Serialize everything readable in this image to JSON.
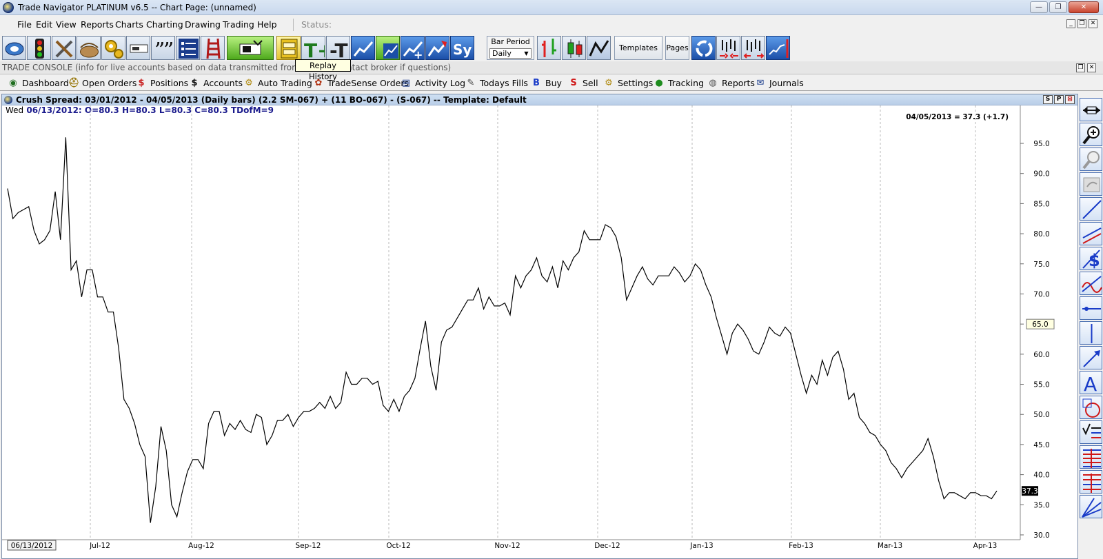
{
  "window": {
    "title": "Trade Navigator PLATINUM v6.5  --  Chart Page: (unnamed)",
    "min": "—",
    "max": "❐",
    "close": "✕"
  },
  "menu": [
    "File",
    "Edit",
    "View",
    "Reports",
    "Charts",
    "Charting",
    "Drawing",
    "Trading",
    "Help"
  ],
  "status_label": "Status:",
  "toolbar": {
    "bar_period_label": "Bar Period",
    "bar_period_value": "Daily",
    "templates": "Templates",
    "pages": "Pages",
    "sym": "Sy"
  },
  "tooltip": "Replay History",
  "trade_console": {
    "label": "TRADE CONSOLE  (info for live accounts based on data transmitted from broker - contact broker if questions)"
  },
  "trade_bar": [
    {
      "label": "Dashboard",
      "icon": "binoculars-icon",
      "glyph": "◉",
      "color": "#1f6e1f"
    },
    {
      "label": "Open Orders",
      "icon": "hardhat-icon",
      "glyph": "⛑",
      "color": "#9a7a10"
    },
    {
      "label": "Positions",
      "icon": "dollar-icon",
      "glyph": "$",
      "color": "#c81e1e"
    },
    {
      "label": "Accounts",
      "icon": "dollar-black-icon",
      "glyph": "$",
      "color": "#111111"
    },
    {
      "label": "Auto Trading",
      "icon": "gears-icon",
      "glyph": "⚙",
      "color": "#b08a10"
    },
    {
      "label": "TradeSense Orders",
      "icon": "tradesense-icon",
      "glyph": "✿",
      "color": "#b03010"
    },
    {
      "label": "Activity Log",
      "icon": "log-icon",
      "glyph": "▤",
      "color": "#1a3c8c"
    },
    {
      "label": "Todays Fills",
      "icon": "fills-icon",
      "glyph": "✎",
      "color": "#444444"
    },
    {
      "label": "Buy",
      "icon": "buy-icon",
      "glyph": "B",
      "color": "#1a3cc8"
    },
    {
      "label": "Sell",
      "icon": "sell-icon",
      "glyph": "S",
      "color": "#d01818"
    },
    {
      "label": "Settings",
      "icon": "settings-icon",
      "glyph": "⚙",
      "color": "#b08a10"
    },
    {
      "label": "Tracking",
      "icon": "globe-icon",
      "glyph": "●",
      "color": "#1e8c1e"
    },
    {
      "label": "Reports",
      "icon": "reports-icon",
      "glyph": "◍",
      "color": "#555555"
    },
    {
      "label": "Journals",
      "icon": "journal-icon",
      "glyph": "✉",
      "color": "#1a3c8c"
    }
  ],
  "chart": {
    "caption": "Crush Spread:  03/01/2012 - 04/05/2013  (Daily bars)   (2.2 SM-067) + (11 BO-067) - (S-067)  --  Template: Default",
    "info_day": "Wed",
    "info_values": "06/13/2012:  O=80.3  H=80.3  L=80.3  C=80.3  TDofM=9",
    "last_label": "04/05/2013 = 37.3 (+1.7)",
    "cursor_value": "65.0",
    "last_value": "37.3",
    "cursor_date": "06/13/2012",
    "caption_buttons": [
      "S",
      "P",
      "⊠"
    ]
  },
  "chart_data": {
    "type": "line",
    "series": [
      {
        "values": [
          87.5,
          82.5,
          83.5,
          84.0,
          84.5,
          80.5,
          78.3,
          79.0,
          80.5,
          87.0,
          79.0,
          96.0,
          74.0,
          75.5,
          69.5,
          74.0,
          74.0,
          69.5,
          69.5,
          67.0,
          67.0,
          61.0,
          52.5,
          51.0,
          48.5,
          45.0,
          43.0,
          32.0,
          38.0,
          48.0,
          44.0,
          35.0,
          33.0,
          37.0,
          40.5,
          42.5,
          42.5,
          41.0,
          48.5,
          50.5,
          50.5,
          46.5,
          48.5,
          47.5,
          49.0,
          47.5,
          47.0,
          50.0,
          49.5,
          45.0,
          46.5,
          49.0,
          49.0,
          50.0,
          48.0,
          49.5,
          50.5,
          50.5,
          51.0,
          52.0,
          51.0,
          53.0,
          51.0,
          52.0,
          57.0,
          55.0,
          55.0,
          56.0,
          56.0,
          55.0,
          55.5,
          51.5,
          50.5,
          52.5,
          50.5,
          53.0,
          54.0,
          56.0,
          61.0,
          65.5,
          58.0,
          54.0,
          62.0,
          64.0,
          64.5,
          66.0,
          67.5,
          69.0,
          69.0,
          71.0,
          67.5,
          69.5,
          68.0,
          68.0,
          68.5,
          66.5,
          73.0,
          71.0,
          73.0,
          74.0,
          76.0,
          73.0,
          72.0,
          74.5,
          71.0,
          75.5,
          74.0,
          76.0,
          77.0,
          80.5,
          79.0,
          79.0,
          79.0,
          81.5,
          81.0,
          79.5,
          76.0,
          69.0,
          71.0,
          73.0,
          74.5,
          72.5,
          71.5,
          73.0,
          73.0,
          73.0,
          74.5,
          73.5,
          72.0,
          73.0,
          75.0,
          74.0,
          71.5,
          69.5,
          66.0,
          63.0,
          60.0,
          63.5,
          65.0,
          64.0,
          62.5,
          60.5,
          60.0,
          62.0,
          64.5,
          63.5,
          63.0,
          64.5,
          63.5,
          60.0,
          56.5,
          53.5,
          56.5,
          55.0,
          59.0,
          56.5,
          59.5,
          60.5,
          57.5,
          52.5,
          53.5,
          49.5,
          48.5,
          47.0,
          46.5,
          45.0,
          44.0,
          42.0,
          41.0,
          39.5,
          41.0,
          42.0,
          43.0,
          44.0,
          46.0,
          43.0,
          39.0,
          36.0,
          37.0,
          37.0,
          36.5,
          36.0,
          37.0,
          37.0,
          36.5,
          36.5,
          36.0,
          37.3
        ]
      }
    ],
    "x_ticks": [
      "Jul-12",
      "Aug-12",
      "Sep-12",
      "Oct-12",
      "Nov-12",
      "Dec-12",
      "Jan-13",
      "Feb-13",
      "Mar-13",
      "Apr-13"
    ],
    "y_ticks": [
      "95.0",
      "90.0",
      "85.0",
      "80.0",
      "75.0",
      "70.0",
      "65.0",
      "60.0",
      "55.0",
      "50.0",
      "45.0",
      "40.0",
      "35.0",
      "30.0"
    ],
    "ylim": [
      30,
      97
    ],
    "grid": "vertical-dashed",
    "line_color": "#000000"
  },
  "side_tools": [
    "pan-icon",
    "zoom-in-icon",
    "zoom-out-icon",
    "undo-zoom-icon",
    "trendline-icon",
    "channel-icon",
    "dollar-tool-icon",
    "sine-icon",
    "horizontal-line-icon",
    "vertical-line-icon",
    "arrow-icon",
    "text-tool-icon",
    "ellipse-icon",
    "checklist-icon",
    "fib-retrace-icon",
    "fib-extension-icon",
    "gann-fan-icon"
  ]
}
